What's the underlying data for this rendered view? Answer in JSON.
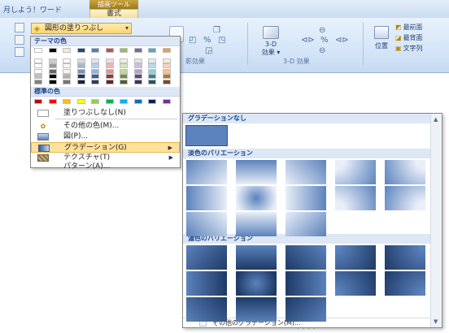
{
  "window": {
    "title": "月しよう！ワード",
    "context_tab_header": "描画ツール",
    "active_tab": "書式"
  },
  "ribbon": {
    "fill_button_label": "図形の塗りつぶし",
    "shadow_group_label": "影効果",
    "threed_button_label": "3-D",
    "threed_button_sub": "効果 ▾",
    "threed_group_label": "3-D 効果",
    "position_button_label": "位置",
    "arrange_items": [
      "最前面",
      "最背面",
      "文字列"
    ]
  },
  "color_menu": {
    "theme_header": "テーマの色",
    "standard_header": "標準の色",
    "items": {
      "no_fill": "塗りつぶしなし(N)",
      "other_color": "その他の色(M)...",
      "picture": "図(P)...",
      "gradient": "グラデーション(G)",
      "texture": "テクスチャ(T)",
      "pattern": "パターン(A)..."
    },
    "theme_colors": [
      "#ffffff",
      "#000000",
      "#eeece1",
      "#1f497d",
      "#4f81bd",
      "#c0504d",
      "#9bbb59",
      "#8064a2",
      "#4bacc6",
      "#f79646"
    ],
    "standard_colors": [
      "#c00000",
      "#ff0000",
      "#ffc000",
      "#ffff00",
      "#92d050",
      "#00b050",
      "#00b0f0",
      "#0070c0",
      "#002060",
      "#7030a0"
    ]
  },
  "gradient_menu": {
    "none_header": "グラデーションなし",
    "light_header": "淡色のバリエーション",
    "dark_header": "濃色のバリエーション",
    "more_label": "その他のグラデーション(M)..."
  },
  "colors": {
    "accent": "#15428b",
    "menu_highlight": "#ffe19b",
    "gradient_base": "#5b82bd"
  }
}
